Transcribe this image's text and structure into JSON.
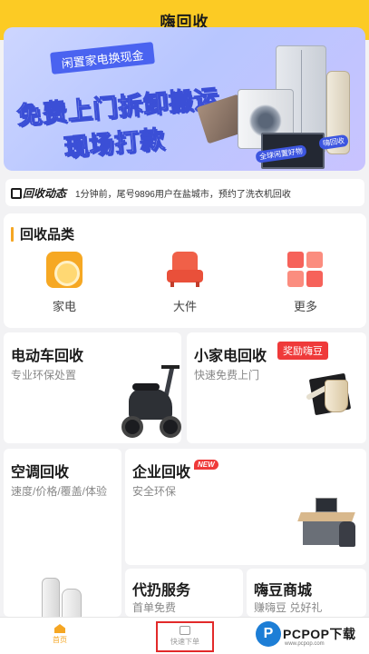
{
  "header": {
    "title": "嗨回收"
  },
  "banner": {
    "ribbon": "闲置家电换现金",
    "line1": "免费上门拆卸搬运",
    "line2": "现场打款",
    "tag1": "全球闲置好物",
    "tag2": "嗨回收"
  },
  "news": {
    "logo": "回收动态",
    "text": "1分钟前，尾号9896用户在盐城市，预约了洗衣机回收"
  },
  "categories": {
    "title": "回收品类",
    "items": [
      {
        "label": "家电",
        "icon": "washer-icon"
      },
      {
        "label": "大件",
        "icon": "sofa-icon"
      },
      {
        "label": "更多",
        "icon": "grid-icon"
      }
    ]
  },
  "cards": {
    "ebike": {
      "title": "电动车回收",
      "sub": "专业环保处置"
    },
    "small_appliance": {
      "title": "小家电回收",
      "badge": "奖励嗨豆",
      "sub": "快速免费上门"
    },
    "aircon": {
      "title": "空调回收",
      "sub": "速度/价格/覆盖/体验"
    },
    "enterprise": {
      "title": "企业回收",
      "badge": "NEW",
      "sub": "安全环保"
    },
    "disposal": {
      "title": "代扔服务",
      "sub": "首单免费"
    },
    "mall": {
      "title": "嗨豆商城",
      "sub": "赚嗨豆 兑好礼"
    }
  },
  "tabbar": {
    "home": "首页",
    "order": "快速下单"
  },
  "watermark": {
    "brand": "PCPOP下载",
    "sub": "www.pcpop.com"
  },
  "colors": {
    "primary": "#fccb24",
    "accent": "#f5a623",
    "badge": "#ef3a3a"
  }
}
